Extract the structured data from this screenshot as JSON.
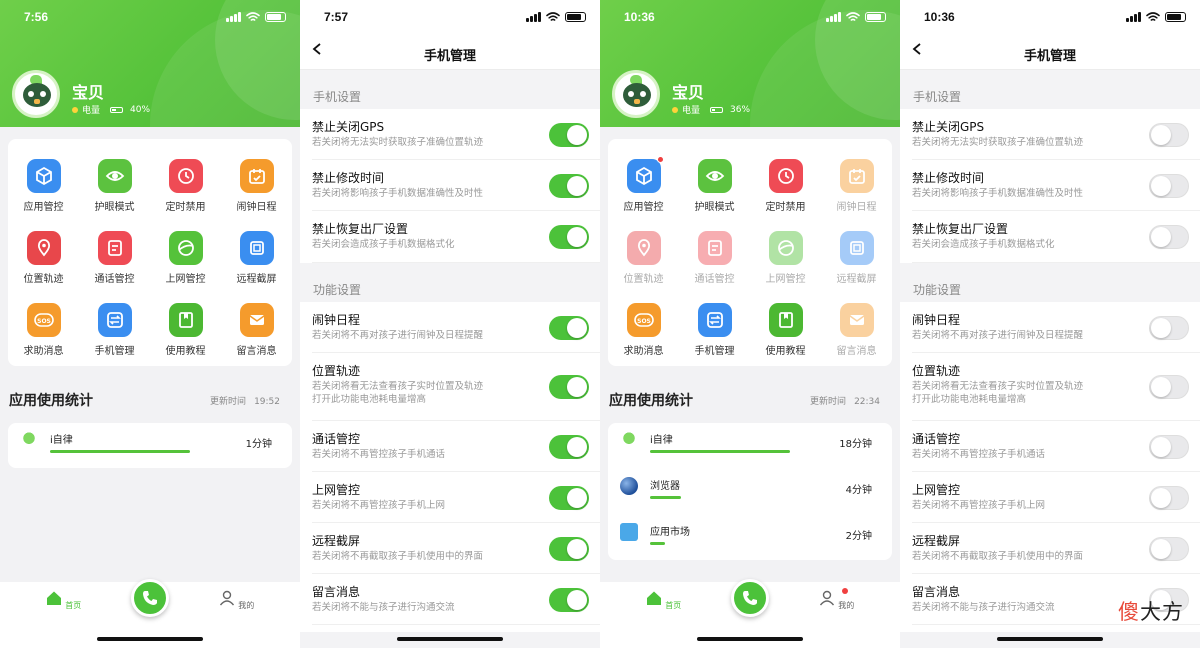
{
  "colors": {
    "brand_green": "#55c23a",
    "toggle_on": "#4cc23a",
    "toggle_off": "#e9e9eb",
    "badge_red": "#f04040"
  },
  "home": {
    "screen1": {
      "time": "7:56",
      "child_name": "宝贝",
      "battery_label": "电量",
      "battery_pct": "40%",
      "battery_level": 0.4
    },
    "screen3": {
      "time": "10:36",
      "child_name": "宝贝",
      "battery_label": "电量",
      "battery_pct": "36%",
      "battery_level": 0.36
    },
    "header_icons": [
      "calendar-icon",
      "bell-icon",
      "device-icon"
    ],
    "grid": [
      {
        "label": "应用管控",
        "icon": "app-control-icon",
        "color": "#3a8ef0"
      },
      {
        "label": "护眼模式",
        "icon": "eye-icon",
        "color": "#5cc23f"
      },
      {
        "label": "定时禁用",
        "icon": "clock-icon",
        "color": "#ef4b55"
      },
      {
        "label": "闹钟日程",
        "icon": "calendar-icon",
        "color": "#f59b2c"
      },
      {
        "label": "位置轨迹",
        "icon": "location-icon",
        "color": "#e8474b"
      },
      {
        "label": "通话管控",
        "icon": "call-log-icon",
        "color": "#ef4b55"
      },
      {
        "label": "上网管控",
        "icon": "globe-icon",
        "color": "#55c23a"
      },
      {
        "label": "远程截屏",
        "icon": "screenshot-icon",
        "color": "#3a8ef0"
      },
      {
        "label": "求助消息",
        "icon": "sos-icon",
        "color": "#f59b2c"
      },
      {
        "label": "手机管理",
        "icon": "phone-manage-icon",
        "color": "#3a8ef0"
      },
      {
        "label": "使用教程",
        "icon": "book-icon",
        "color": "#4cb832"
      },
      {
        "label": "留言消息",
        "icon": "mail-icon",
        "color": "#f59b2c"
      }
    ],
    "stats_title": "应用使用统计",
    "update_label": "更新时间",
    "screen1_update_time": "19:52",
    "screen3_update_time": "22:34",
    "screen1_usage": [
      {
        "name": "i自律",
        "minutes": "1分钟",
        "share": 1.0
      }
    ],
    "screen3_usage": [
      {
        "name": "i自律",
        "minutes": "18分钟",
        "share": 1.0
      },
      {
        "name": "浏览器",
        "minutes": "4分钟",
        "share": 0.22
      },
      {
        "name": "应用市场",
        "minutes": "2分钟",
        "share": 0.11
      }
    ],
    "tabs": {
      "home": "首页",
      "mine": "我的"
    }
  },
  "settings": {
    "screen2_time": "7:57",
    "screen4_time": "10:36",
    "title": "手机管理",
    "phone_section": "手机设置",
    "feature_section": "功能设置",
    "phone_rows": [
      {
        "title": "禁止关闭GPS",
        "desc": [
          "若关闭将无法实时获取孩子准确位置轨迹"
        ]
      },
      {
        "title": "禁止修改时间",
        "desc": [
          "若关闭将影响孩子手机数据准确性及时性"
        ]
      },
      {
        "title": "禁止恢复出厂设置",
        "desc": [
          "若关闭会造成孩子手机数据格式化"
        ]
      }
    ],
    "feature_rows": [
      {
        "title": "闹钟日程",
        "desc": [
          "若关闭将不再对孩子进行闹钟及日程提醒"
        ]
      },
      {
        "title": "位置轨迹",
        "desc": [
          "若关闭将看无法查看孩子实时位置及轨迹",
          "打开此功能电池耗电量增高"
        ]
      },
      {
        "title": "通话管控",
        "desc": [
          "若关闭将不再管控孩子手机通话"
        ]
      },
      {
        "title": "上网管控",
        "desc": [
          "若关闭将不再管控孩子手机上网"
        ]
      },
      {
        "title": "远程截屏",
        "desc": [
          "若关闭将不再截取孩子手机使用中的界面"
        ]
      },
      {
        "title": "留言消息",
        "desc": [
          "若关闭将不能与孩子进行沟通交流"
        ]
      }
    ]
  },
  "watermark": "傻大方"
}
